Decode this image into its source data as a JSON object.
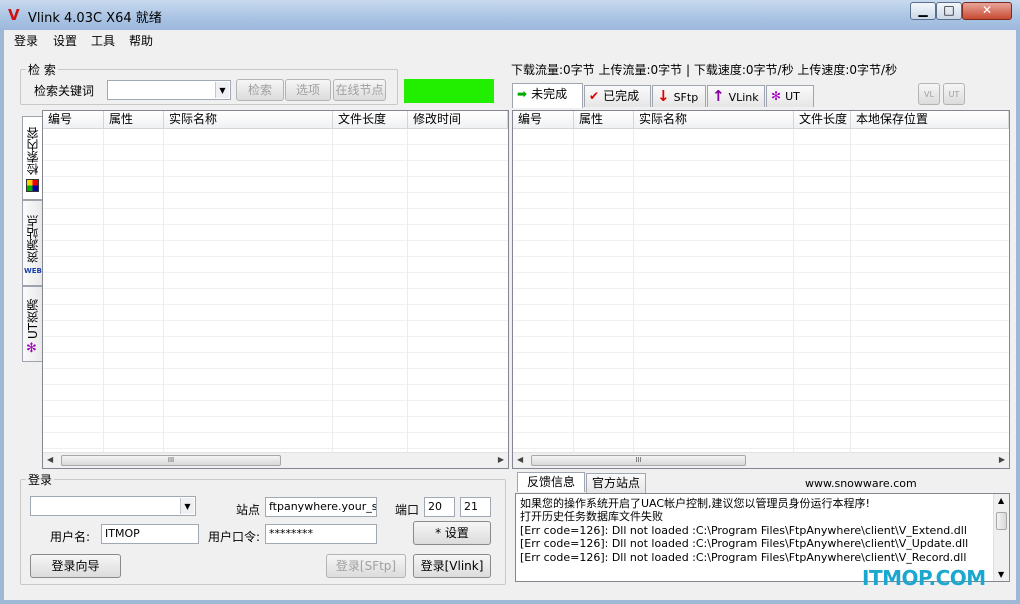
{
  "window": {
    "logo": "V",
    "title": "Vlink 4.03C X64 就绪",
    "min_glyph": "▁",
    "max_glyph": "□",
    "close_glyph": "✕",
    "accent": "#d01010"
  },
  "menu": [
    {
      "label": "登录"
    },
    {
      "label": "设置"
    },
    {
      "label": "工具"
    },
    {
      "label": "帮助"
    }
  ],
  "search": {
    "group_label": "检 索",
    "keyword_label": "检索关键词",
    "keyword_value": "",
    "search_button": "检索",
    "options_button": "选项",
    "online_nodes_button": "在线节点",
    "status_color": "#22ee00"
  },
  "left_tabs": [
    {
      "label": "检索内容",
      "icon": "palette-icon"
    },
    {
      "label": "资源站点",
      "icon": "web-icon",
      "icon_text": "WEB"
    },
    {
      "label": "UT资源",
      "icon": "ut-icon"
    }
  ],
  "search_table": {
    "columns": [
      "编号",
      "属性",
      "实际名称",
      "文件长度",
      "修改时间"
    ],
    "rows": [],
    "scroll_glyph": "III"
  },
  "stats": {
    "text": "下载流量:0字节 上传流量:0字节 | 下载速度:0字节/秒 上传速度:0字节/秒"
  },
  "transfer_tabs": [
    {
      "label": "未完成",
      "icon": "arrow-right-icon",
      "glyph": "➡",
      "color": "#00aa00"
    },
    {
      "label": "已完成",
      "icon": "check-icon",
      "glyph": "✔",
      "color": "#e00000"
    },
    {
      "label": "SFtp",
      "icon": "arrow-down-icon",
      "glyph": "↓",
      "color": "#e00000"
    },
    {
      "label": "VLink",
      "icon": "arrow-up-icon",
      "glyph": "↑",
      "color": "#8000a0"
    },
    {
      "label": "UT",
      "icon": "ut-icon",
      "glyph": "✻",
      "color": "#a000c0"
    }
  ],
  "toolbar_icons": [
    {
      "name": "up-vlink-icon",
      "text": "VL"
    },
    {
      "name": "up-ut-icon",
      "text": "UT"
    }
  ],
  "transfer_table": {
    "columns": [
      "编号",
      "属性",
      "实际名称",
      "文件长度",
      "本地保存位置"
    ],
    "rows": [],
    "scroll_glyph": "III"
  },
  "login": {
    "group_label": "登录",
    "profile_value": "",
    "site_label": "站点",
    "site_value": "ftpanywhere.your_site",
    "port_label": "端口",
    "port1": "20",
    "port2": "21",
    "user_label": "用户名:",
    "user_value": "ITMOP",
    "password_label": "用户口令:",
    "password_value": "********",
    "settings_button": "* 设置",
    "wizard_button": "登录向导",
    "sftp_button": "登录[SFtp]",
    "vlink_button": "登录[Vlink]"
  },
  "feedback": {
    "tabs": [
      {
        "label": "反馈信息"
      },
      {
        "label": "官方站点"
      }
    ],
    "site_url": "www.snowware.com",
    "lines": [
      "如果您的操作系统开启了UAC帐户控制,建议您以管理员身份运行本程序!",
      "打开历史任务数据库文件失败",
      "[Err code=126]: Dll not loaded :C:\\Program Files\\FtpAnywhere\\client\\V_Extend.dll",
      "[Err code=126]: Dll not loaded :C:\\Program Files\\FtpAnywhere\\client\\V_Update.dll",
      "[Err code=126]: Dll not loaded :C:\\Program Files\\FtpAnywhere\\client\\V_Record.dll"
    ]
  },
  "watermark": "ITMOP.COM"
}
